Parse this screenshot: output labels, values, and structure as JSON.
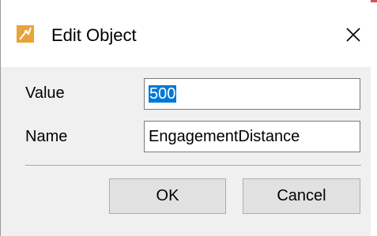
{
  "window": {
    "title": "Edit Object",
    "icon": "app-icon",
    "close_icon": "close-icon"
  },
  "form": {
    "value_label": "Value",
    "value_text": "500",
    "name_label": "Name",
    "name_text": "EngagementDistance"
  },
  "buttons": {
    "ok_label": "OK",
    "cancel_label": "Cancel"
  },
  "colors": {
    "selection_bg": "#0078d7",
    "dialog_bg": "#f0f0f0",
    "button_bg": "#e1e1e1"
  }
}
